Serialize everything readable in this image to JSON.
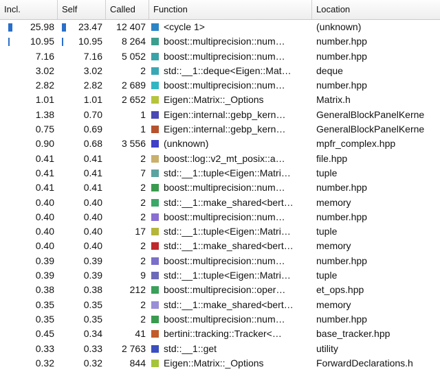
{
  "header": {
    "incl": "Incl.",
    "self": "Self",
    "called": "Called",
    "function": "Function",
    "location": "Location"
  },
  "rows": [
    {
      "incl": "25.98",
      "self": "23.47",
      "called": "12 407",
      "func": "<cycle 1>",
      "loc": "(unknown)",
      "color": "#2b84c6",
      "incl_bar": 1.0,
      "self_bar": 1.0
    },
    {
      "incl": "10.95",
      "self": "10.95",
      "called": "8 264",
      "func": "boost::multiprecision::num…",
      "loc": "number.hpp",
      "color": "#3c9e8e",
      "incl_bar": 0.4,
      "self_bar": 0.4
    },
    {
      "incl": "7.16",
      "self": "7.16",
      "called": "5 052",
      "func": "boost::multiprecision::num…",
      "loc": "number.hpp",
      "color": "#3aa3a8"
    },
    {
      "incl": "3.02",
      "self": "3.02",
      "called": "2",
      "func": "std::__1::deque<Eigen::Mat…",
      "loc": "deque",
      "color": "#3aa7b5"
    },
    {
      "incl": "2.82",
      "self": "2.82",
      "called": "2 689",
      "func": "boost::multiprecision::num…",
      "loc": "number.hpp",
      "color": "#33b6c4"
    },
    {
      "incl": "1.01",
      "self": "1.01",
      "called": "2 652",
      "func": "Eigen::Matrix::_Options",
      "loc": "Matrix.h",
      "color": "#b6c43a"
    },
    {
      "incl": "1.38",
      "self": "0.70",
      "called": "1",
      "func": "Eigen::internal::gebp_kern…",
      "loc": "GeneralBlockPanelKerne",
      "color": "#4b49b3"
    },
    {
      "incl": "0.75",
      "self": "0.69",
      "called": "1",
      "func": "Eigen::internal::gebp_kern…",
      "loc": "GeneralBlockPanelKerne",
      "color": "#b5532f"
    },
    {
      "incl": "0.90",
      "self": "0.68",
      "called": "3 556",
      "func": "(unknown)",
      "loc": "mpfr_complex.hpp",
      "color": "#3f3fc8"
    },
    {
      "incl": "0.41",
      "self": "0.41",
      "called": "2",
      "func": "boost::log::v2_mt_posix::a…",
      "loc": "file.hpp",
      "color": "#c9b06b"
    },
    {
      "incl": "0.41",
      "self": "0.41",
      "called": "7",
      "func": "std::__1::tuple<Eigen::Matri…",
      "loc": "tuple",
      "color": "#5aa3a0"
    },
    {
      "incl": "0.41",
      "self": "0.41",
      "called": "2",
      "func": "boost::multiprecision::num…",
      "loc": "number.hpp",
      "color": "#3a9b4f"
    },
    {
      "incl": "0.40",
      "self": "0.40",
      "called": "2",
      "func": "std::__1::make_shared<bert…",
      "loc": "memory",
      "color": "#3aa866"
    },
    {
      "incl": "0.40",
      "self": "0.40",
      "called": "2",
      "func": "boost::multiprecision::num…",
      "loc": "number.hpp",
      "color": "#8a6ed1"
    },
    {
      "incl": "0.40",
      "self": "0.40",
      "called": "17",
      "func": "std::__1::tuple<Eigen::Matri…",
      "loc": "tuple",
      "color": "#b5b53a"
    },
    {
      "incl": "0.40",
      "self": "0.40",
      "called": "2",
      "func": "std::__1::make_shared<bert…",
      "loc": "memory",
      "color": "#c0282d"
    },
    {
      "incl": "0.39",
      "self": "0.39",
      "called": "2",
      "func": "boost::multiprecision::num…",
      "loc": "number.hpp",
      "color": "#7a6fc9"
    },
    {
      "incl": "0.39",
      "self": "0.39",
      "called": "9",
      "func": "std::__1::tuple<Eigen::Matri…",
      "loc": "tuple",
      "color": "#6c6ab8"
    },
    {
      "incl": "0.38",
      "self": "0.38",
      "called": "212",
      "func": "boost::multiprecision::oper…",
      "loc": "et_ops.hpp",
      "color": "#3aa05a"
    },
    {
      "incl": "0.35",
      "self": "0.35",
      "called": "2",
      "func": "std::__1::make_shared<bert…",
      "loc": "memory",
      "color": "#9a8fd6"
    },
    {
      "incl": "0.35",
      "self": "0.35",
      "called": "2",
      "func": "boost::multiprecision::num…",
      "loc": "number.hpp",
      "color": "#3a9b4f"
    },
    {
      "incl": "0.45",
      "self": "0.34",
      "called": "41",
      "func": "bertini::tracking::Tracker<…",
      "loc": "base_tracker.hpp",
      "color": "#c25a2a"
    },
    {
      "incl": "0.33",
      "self": "0.33",
      "called": "2 763",
      "func": "std::__1::get",
      "loc": "utility",
      "color": "#3a4fc0"
    },
    {
      "incl": "0.32",
      "self": "0.32",
      "called": "844",
      "func": "Eigen::Matrix::_Options",
      "loc": "ForwardDeclarations.h",
      "color": "#a6c43a"
    }
  ]
}
